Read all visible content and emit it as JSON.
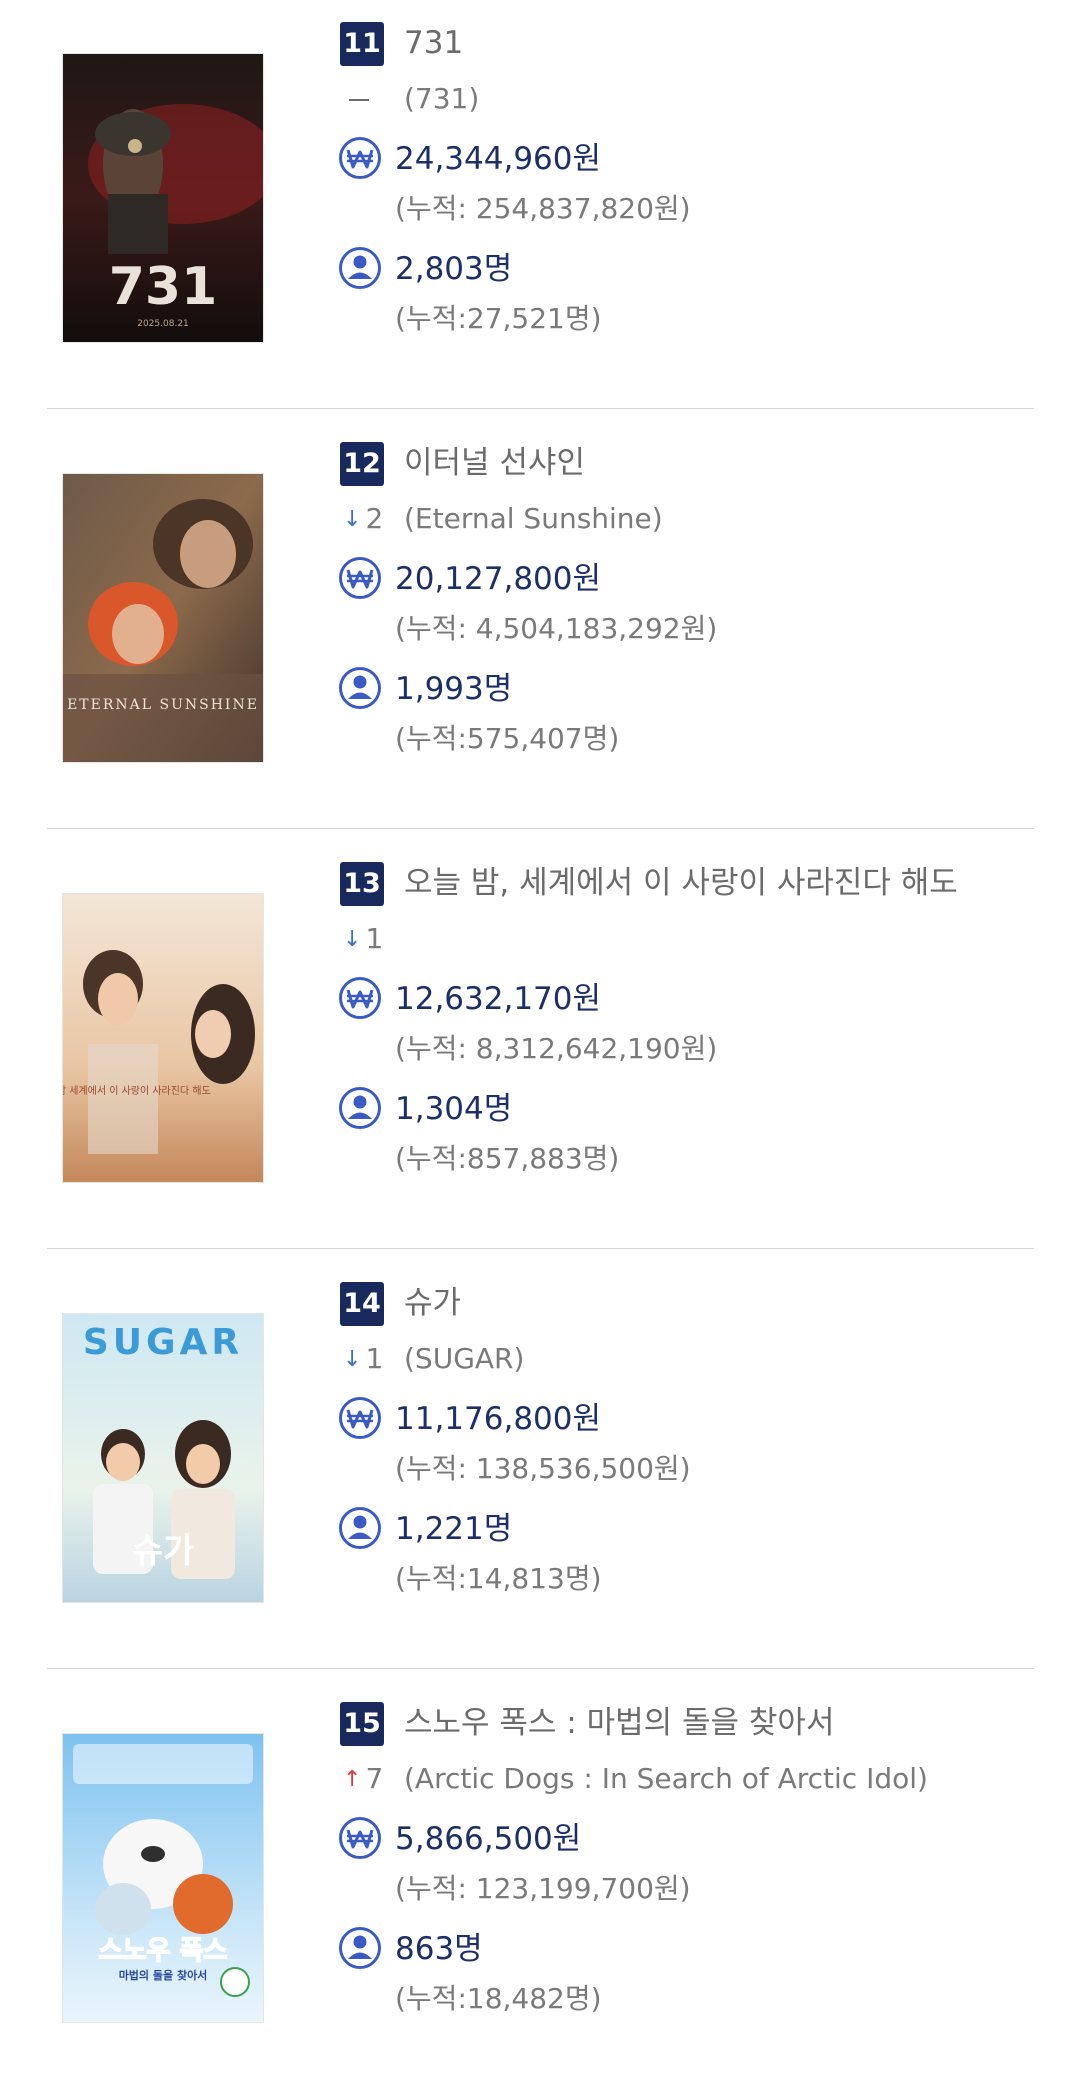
{
  "colors": {
    "badge_bg": "#17295d",
    "value_text": "#1c2f6b",
    "muted_text": "#7a7a7a",
    "arrow_down": "#3b6fd1",
    "arrow_up": "#e0383b",
    "divider": "#d7d7d7"
  },
  "icons": {
    "revenue": "won-currency-icon",
    "audience": "person-icon"
  },
  "items": [
    {
      "rank": "11",
      "title": "731",
      "change_symbol": "—",
      "change_value": "",
      "change_direction": "none",
      "original_title": "(731)",
      "revenue": "24,344,960원",
      "revenue_cumulative": "(누적: 254,837,820원)",
      "audience": "2,803명",
      "audience_cumulative": "(누적:27,521명)",
      "poster_label": "731",
      "poster_sublabel": "2025.08.21"
    },
    {
      "rank": "12",
      "title": "이터널 선샤인",
      "change_symbol": "↓",
      "change_value": "2",
      "change_direction": "down",
      "original_title": "(Eternal Sunshine)",
      "revenue": "20,127,800원",
      "revenue_cumulative": "(누적: 4,504,183,292원)",
      "audience": "1,993명",
      "audience_cumulative": "(누적:575,407명)",
      "poster_label": "ETERNAL SUNSHINE",
      "poster_sublabel": ""
    },
    {
      "rank": "13",
      "title": "오늘 밤, 세계에서 이 사랑이 사라진다 해도",
      "change_symbol": "↓",
      "change_value": "1",
      "change_direction": "down",
      "original_title": "",
      "revenue": "12,632,170원",
      "revenue_cumulative": "(누적: 8,312,642,190원)",
      "audience": "1,304명",
      "audience_cumulative": "(누적:857,883명)",
      "poster_label": "오늘 밤 세계에서 이 사랑이 사라진다 해도",
      "poster_sublabel": ""
    },
    {
      "rank": "14",
      "title": "슈가",
      "change_symbol": "↓",
      "change_value": "1",
      "change_direction": "down",
      "original_title": "(SUGAR)",
      "revenue": "11,176,800원",
      "revenue_cumulative": "(누적: 138,536,500원)",
      "audience": "1,221명",
      "audience_cumulative": "(누적:14,813명)",
      "poster_label": "SUGAR",
      "poster_sublabel": "슈가"
    },
    {
      "rank": "15",
      "title": "스노우 폭스 : 마법의 돌을 찾아서",
      "change_symbol": "↑",
      "change_value": "7",
      "change_direction": "up",
      "original_title": "(Arctic Dogs : In Search of Arctic Idol)",
      "revenue": "5,866,500원",
      "revenue_cumulative": "(누적: 123,199,700원)",
      "audience": "863명",
      "audience_cumulative": "(누적:18,482명)",
      "poster_label": "스노우 폭스",
      "poster_sublabel": "마법의 돌을 찾아서"
    }
  ]
}
